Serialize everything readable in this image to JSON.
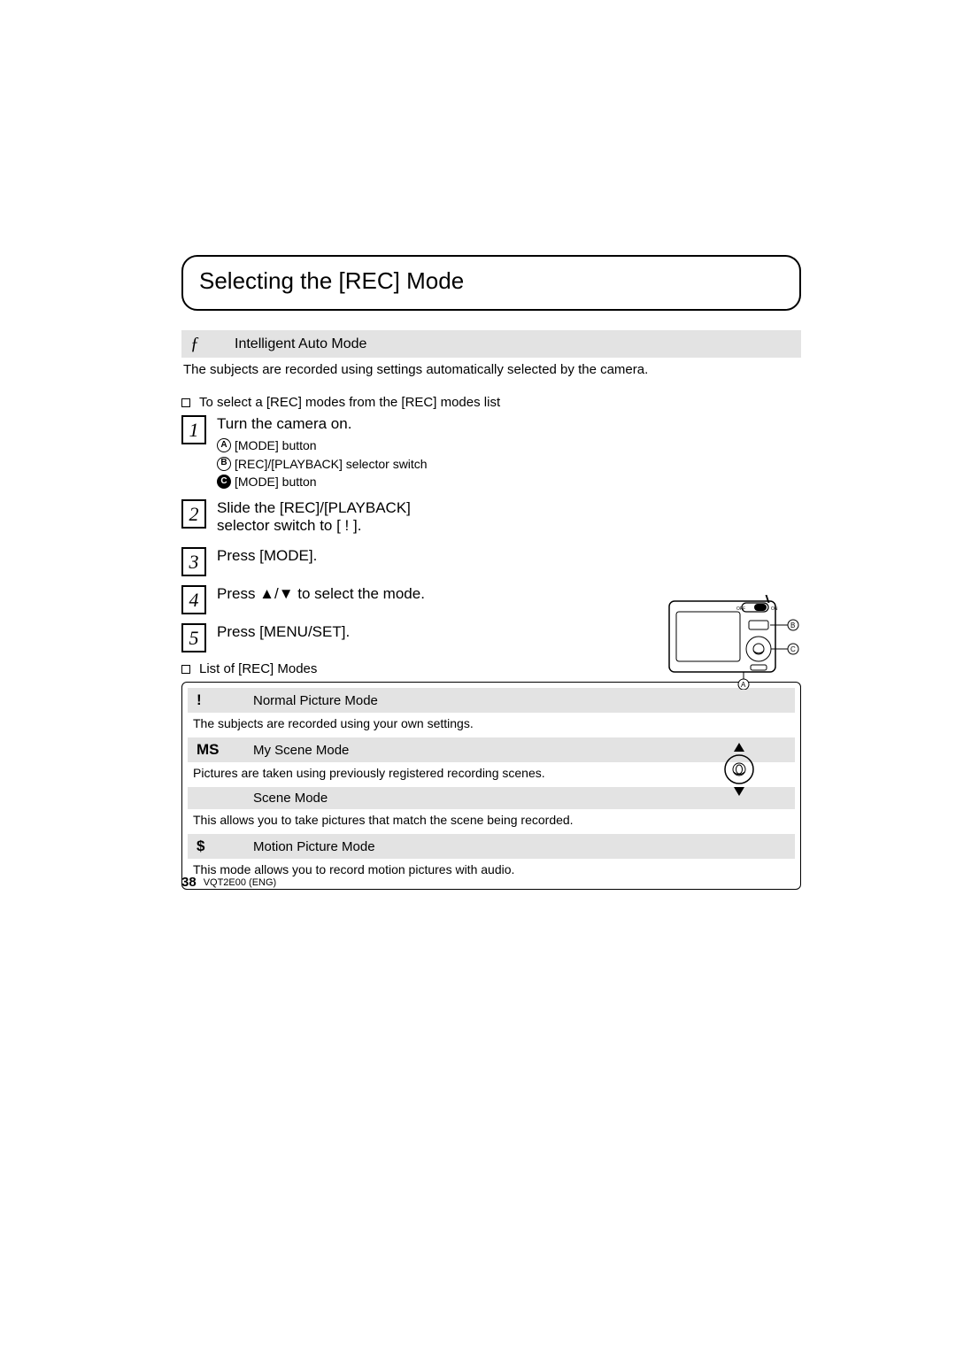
{
  "title": "Selecting the [REC] Mode",
  "iauto": {
    "icon": "ƒ",
    "label": "Intelligent Auto Mode",
    "desc": "The subjects are recorded using settings automatically selected by the camera."
  },
  "to_select": "To select a [REC] modes from the [REC] modes list",
  "steps": [
    {
      "num": "1",
      "title": "Turn the camera on.",
      "sublines": [
        {
          "marker": "A",
          "text": "[MODE] button"
        },
        {
          "marker": "B",
          "text": "[REC]/[PLAYBACK] selector switch"
        },
        {
          "marker": "C",
          "text": "[MODE] button",
          "inv": true
        }
      ]
    },
    {
      "num": "2",
      "title_a": "Slide the [REC]/[PLAYBACK]",
      "title_b": "selector switch to [      !      ].",
      "sublines": []
    },
    {
      "num": "3",
      "title": "Press [MODE].",
      "sublines": []
    },
    {
      "num": "4",
      "title": "Press ▲/▼ to select the mode.",
      "sublines": []
    },
    {
      "num": "5",
      "title": "Press [MENU/SET].",
      "sublines": []
    }
  ],
  "list_heading": "List of [REC] Modes",
  "modes": [
    {
      "icon": "!",
      "name": "Normal Picture Mode",
      "desc": "The subjects are recorded using your own settings."
    },
    {
      "icon": "MS",
      "name": "My Scene Mode",
      "desc": "Pictures are taken using previously registered recording scenes."
    },
    {
      "icon": "",
      "name": "Scene Mode",
      "desc": "This allows you to take pictures that match the scene being recorded."
    },
    {
      "icon": "$",
      "name": "Motion Picture Mode",
      "desc": "This mode allows you to record motion pictures with audio."
    }
  ],
  "page_number": "38",
  "model": "VQT2E00 (ENG)",
  "camera_labels": {
    "off": "OFF",
    "on": "ON",
    "a": "A",
    "b": "B",
    "c": "C"
  }
}
